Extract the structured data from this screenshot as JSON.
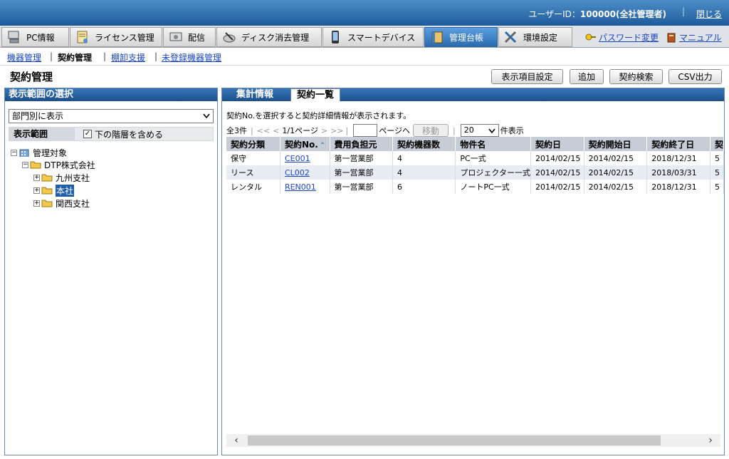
{
  "header": {
    "user_label": "ユーザーID：",
    "user_value": "100000(全社管理者)",
    "logout": "閉じる"
  },
  "nav": {
    "tabs": [
      {
        "label": "PC情報",
        "icon": "computer-icon"
      },
      {
        "label": "ライセンス管理",
        "icon": "license-icon"
      },
      {
        "label": "配信",
        "icon": "distribution-icon"
      },
      {
        "label": "ディスク消去管理",
        "icon": "disk-erase-icon"
      },
      {
        "label": "スマートデバイス",
        "icon": "smartphone-icon"
      },
      {
        "label": "管理台帳",
        "icon": "ledger-icon"
      },
      {
        "label": "環境設定",
        "icon": "tools-icon"
      }
    ],
    "password_link": "パスワード変更",
    "manual_link": "マニュアル"
  },
  "subnav": {
    "items": [
      "機器管理",
      "契約管理",
      "棚卸支援",
      "未登録機器管理"
    ]
  },
  "page": {
    "title": "契約管理"
  },
  "toolbar": {
    "display_settings": "表示項目設定",
    "add": "追加",
    "search": "契約検索",
    "csv": "CSV出力"
  },
  "left": {
    "header": "表示範囲の選択",
    "view_select": "部門別に表示",
    "range_label": "表示範囲",
    "include_sub_label": "下の階層を含める",
    "include_sub_checked": true,
    "tree": [
      {
        "label": "管理対象"
      },
      {
        "label": "DTP株式会社"
      },
      {
        "label": "九州支社"
      },
      {
        "label": "本社"
      },
      {
        "label": "関西支社"
      }
    ]
  },
  "right": {
    "tabs": [
      "集計情報",
      "契約一覧"
    ],
    "info": "契約No.を選択すると契約詳細情報が表示されます。",
    "pager": {
      "total": "全3件",
      "first": "<<",
      "prev": "<",
      "page": "1/1ページ",
      "next": ">",
      "last": ">>",
      "page_to": "ページへ",
      "move": "移動",
      "per_page_value": "20",
      "per_page_suffix": "件表示"
    },
    "columns": [
      "契約分類",
      "契約No.",
      "費用負担元",
      "契約機器数",
      "物件名",
      "契約日",
      "契約開始日",
      "契約終了日",
      "契"
    ],
    "rows": [
      [
        "保守",
        "CE001",
        "第一営業部",
        "4",
        "PC一式",
        "2014/02/15",
        "2014/02/15",
        "2018/12/31",
        "5"
      ],
      [
        "リース",
        "CL002",
        "第一営業部",
        "4",
        "プロジェクター一式",
        "2014/02/15",
        "2014/02/15",
        "2018/03/31",
        "5"
      ],
      [
        "レンタル",
        "REN001",
        "第一営業部",
        "6",
        "ノートPC一式",
        "2014/02/15",
        "2014/02/15",
        "2018/12/31",
        "5"
      ]
    ]
  }
}
